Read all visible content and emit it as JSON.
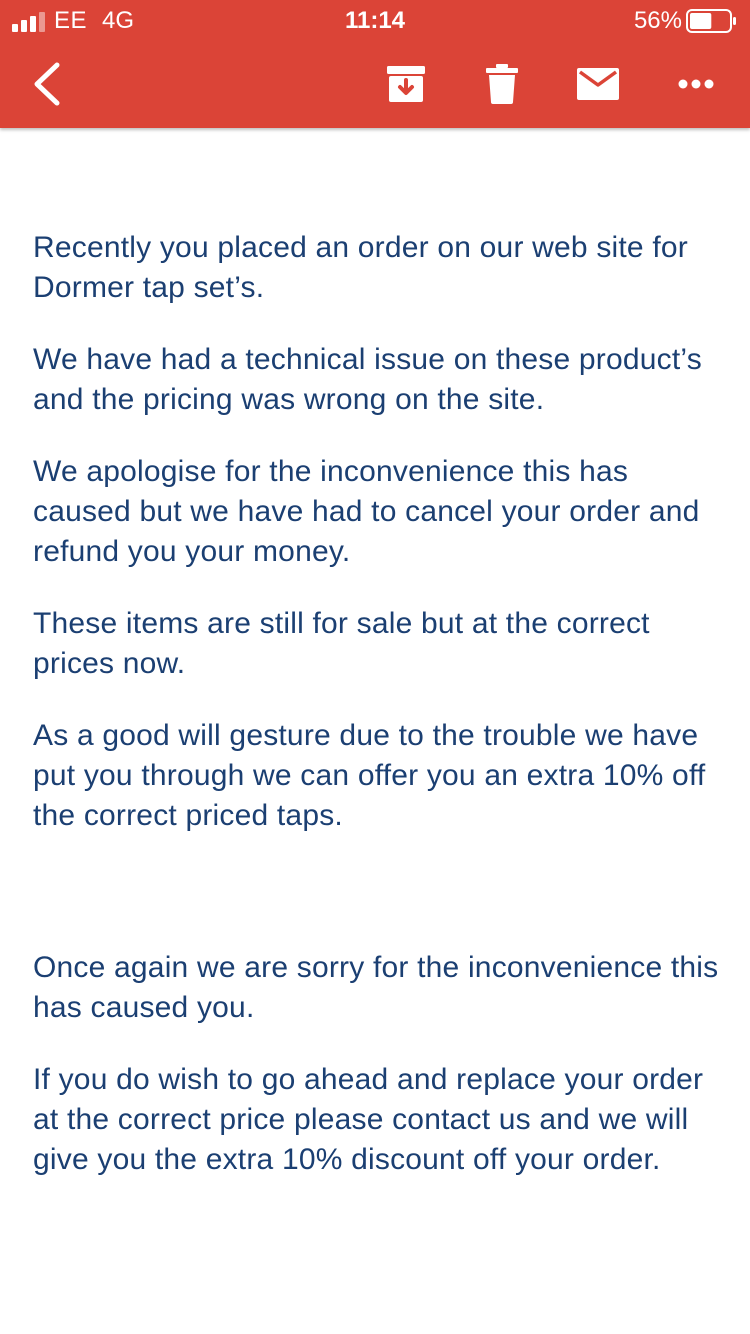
{
  "status_bar": {
    "carrier": "EE",
    "network": "4G",
    "time": "11:14",
    "battery_percent": "56%",
    "battery_level": 0.56
  },
  "toolbar": {
    "color": "#db4437",
    "icons": [
      "back-icon",
      "archive-icon",
      "delete-icon",
      "mail-icon",
      "more-icon"
    ]
  },
  "email": {
    "text_color": "#1b3f72",
    "paragraphs": [
      "Recently you placed an order on our web site for Dormer tap set’s.",
      "We have had a technical issue on these product’s and the pricing was wrong on the site.",
      "We apologise for the inconvenience this has caused but we have had to cancel your order and refund you your money.",
      "These items are still for sale but at the correct prices now.",
      "As a good will gesture due to the trouble we have put you through we can offer you an extra 10% off the correct priced taps.",
      "Once again we are sorry for the inconvenience this has caused you.",
      "If you do wish to go ahead and replace your order at the correct price please contact us and we will give you the extra 10% discount off your order."
    ]
  }
}
